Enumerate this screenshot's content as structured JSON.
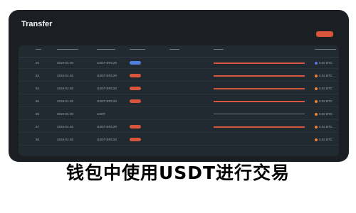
{
  "window": {
    "title": "Transfer"
  },
  "colors": {
    "accent": "#d8553d",
    "blue": "#4f7ee0",
    "dark": "#1b1e23",
    "panel": "#222a31"
  },
  "table": {
    "rows": [
      {
        "id": "82",
        "date": "2019-01-30",
        "name": "USDT-ERC20",
        "status": "blue",
        "detail": "long",
        "amount": "0.02 BTC",
        "dot_color": "#4f7ee0"
      },
      {
        "id": "83",
        "date": "2019-01-30",
        "name": "USDT-ERC20",
        "status": "red",
        "detail": "long",
        "amount": "0.02 BTC",
        "dot_color": "#e8833a"
      },
      {
        "id": "84",
        "date": "2019-01-30",
        "name": "USDT-ERC20",
        "status": "red",
        "detail": "long",
        "amount": "0.02 BTC",
        "dot_color": "#e8833a"
      },
      {
        "id": "85",
        "date": "2019-01-30",
        "name": "USDT-ERC20",
        "status": "red",
        "detail": "long",
        "amount": "0.02 BTC",
        "dot_color": "#e8833a"
      },
      {
        "id": "86",
        "date": "2019-01-30",
        "name": "USDT",
        "status": "none",
        "detail": "text",
        "amount": "0.02 BTC",
        "dot_color": "#e8833a"
      },
      {
        "id": "87",
        "date": "2019-01-30",
        "name": "USDT-ERC20",
        "status": "red",
        "detail": "long",
        "amount": "0.02 BTC",
        "dot_color": "#e8833a"
      },
      {
        "id": "88",
        "date": "2019-01-30",
        "name": "USDT-ERC20",
        "status": "red",
        "detail": "none",
        "amount": "0.02 BTC",
        "dot_color": "#e8833a"
      }
    ]
  },
  "banner": {
    "text": "钱包中使用USDT进行交易"
  }
}
